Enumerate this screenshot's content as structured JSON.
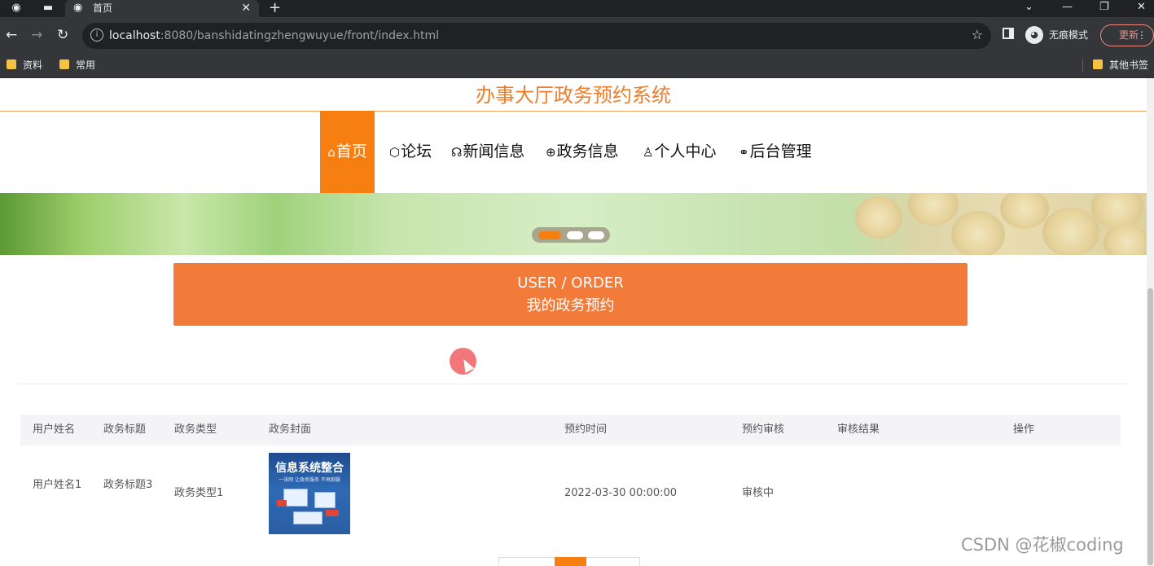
{
  "browser": {
    "tab_title": "首页",
    "url_host": "localhost",
    "url_rest": ":8080/banshidatingzhengwuyue/front/index.html",
    "incognito_label": "无痕模式",
    "update_label": "更新",
    "bookmarks": [
      "资料",
      "常用"
    ],
    "other_bookmarks": "其他书签"
  },
  "site": {
    "title": "办事大厅政务预约系统",
    "accent_color": "#f77f12"
  },
  "menu": [
    {
      "label": "首页",
      "icon": "home-icon",
      "glyph": "⌂",
      "active": true
    },
    {
      "label": "论坛",
      "icon": "cube-icon",
      "glyph": "⬡",
      "active": false
    },
    {
      "label": "新闻信息",
      "icon": "gamepad-icon",
      "glyph": "☊",
      "active": false
    },
    {
      "label": "政务信息",
      "icon": "globe-icon",
      "glyph": "⊕",
      "active": false
    },
    {
      "label": "个人中心",
      "icon": "user-icon",
      "glyph": "♙",
      "active": false
    },
    {
      "label": "后台管理",
      "icon": "link-icon",
      "glyph": "⚭",
      "active": false
    }
  ],
  "carousel": {
    "active_index": 0,
    "count": 3
  },
  "section": {
    "en": "USER / ORDER",
    "zh": "我的政务预约"
  },
  "table": {
    "headers": [
      "用户姓名",
      "政务标题",
      "政务类型",
      "政务封面",
      "预约时间",
      "预约审核",
      "审核结果",
      "操作"
    ],
    "rows": [
      {
        "user_name": "用户姓名1",
        "gov_title": "政务标题3",
        "gov_type": "政务类型1",
        "cover_title": "信息系统整合",
        "cover_sub": "一张网 让政务服务 不再跑腿",
        "time": "2022-03-30 00:00:00",
        "review": "审核中",
        "result": ""
      }
    ]
  },
  "watermark": "CSDN @花椒coding"
}
